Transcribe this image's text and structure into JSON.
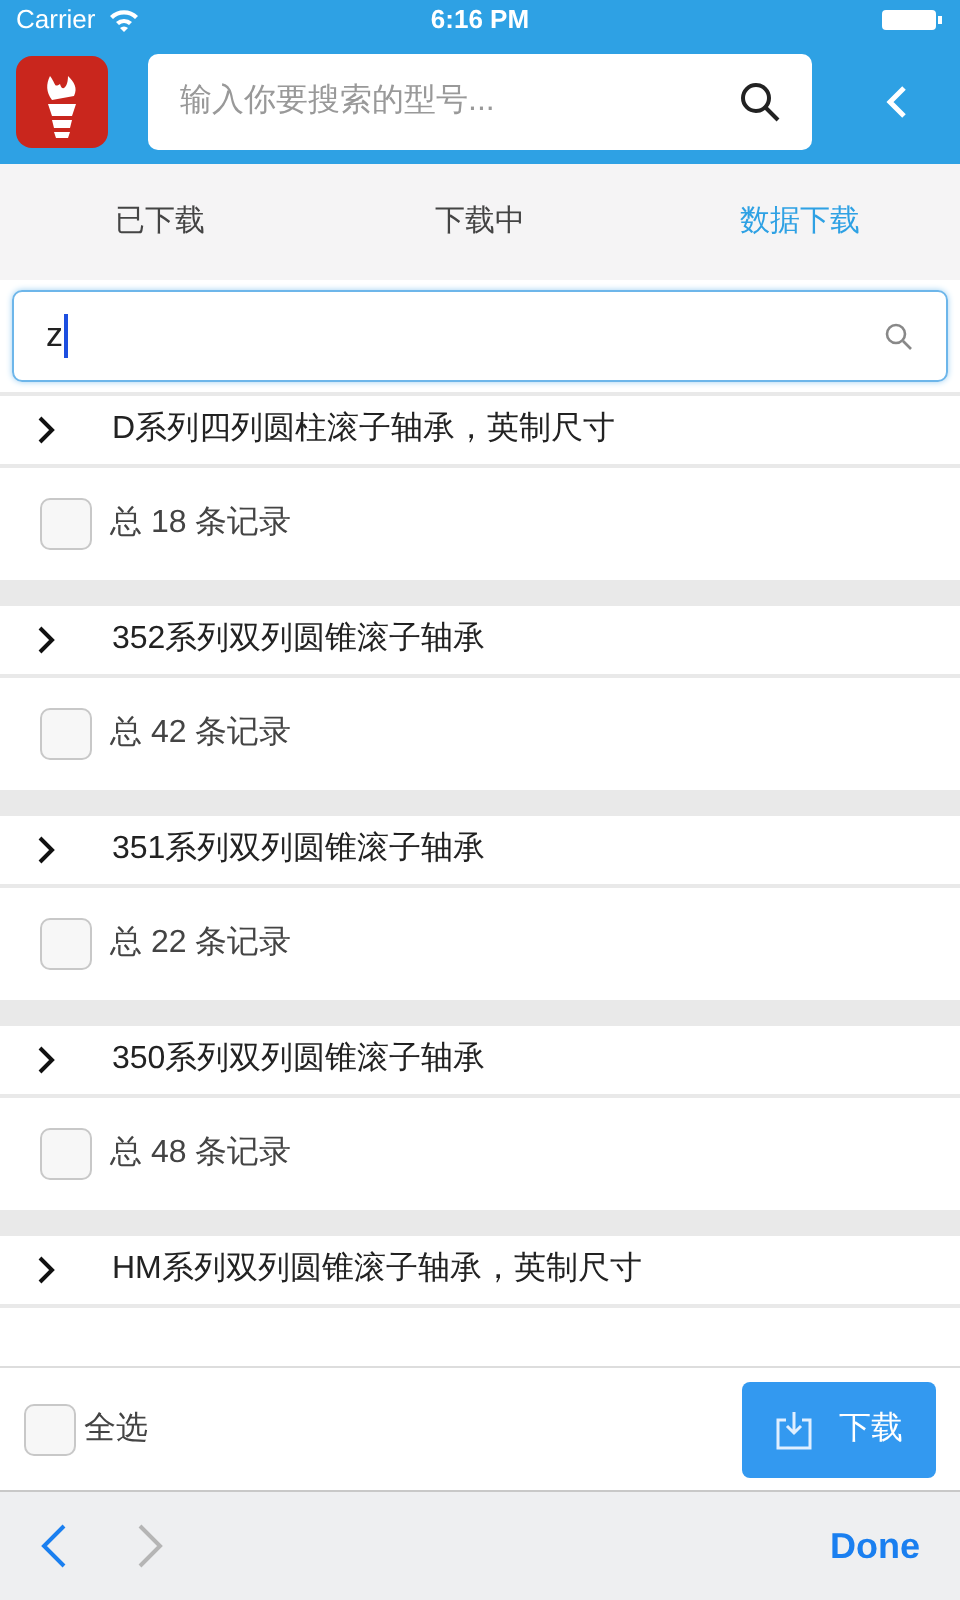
{
  "status_bar": {
    "carrier": "Carrier",
    "time": "6:16 PM"
  },
  "header": {
    "search": {
      "placeholder": "输入你要搜索的型号..."
    }
  },
  "tabs": [
    {
      "label": "已下载",
      "selected": false
    },
    {
      "label": "下载中",
      "selected": false
    },
    {
      "label": "数据下载",
      "selected": true
    }
  ],
  "filter": {
    "value": "z"
  },
  "groups": [
    {
      "title": "D系列四列圆柱滚子轴承，英制尺寸",
      "expanded": false,
      "record": "总 18 条记录",
      "checked": false
    },
    {
      "title": "352系列双列圆锥滚子轴承",
      "expanded": false,
      "record": "总 42 条记录",
      "checked": false
    },
    {
      "title": "351系列双列圆锥滚子轴承",
      "expanded": false,
      "record": "总 22 条记录",
      "checked": false
    },
    {
      "title": "350系列双列圆锥滚子轴承",
      "expanded": false,
      "record": "总 48 条记录",
      "checked": false
    },
    {
      "title": "HM系列双列圆锥滚子轴承，英制尺寸",
      "expanded": false
    }
  ],
  "footer": {
    "select_all": {
      "label": "全选",
      "checked": false
    },
    "download_button": "下载"
  },
  "keyboard_bar": {
    "prev_disabled": false,
    "next_disabled": true,
    "done": "Done"
  }
}
